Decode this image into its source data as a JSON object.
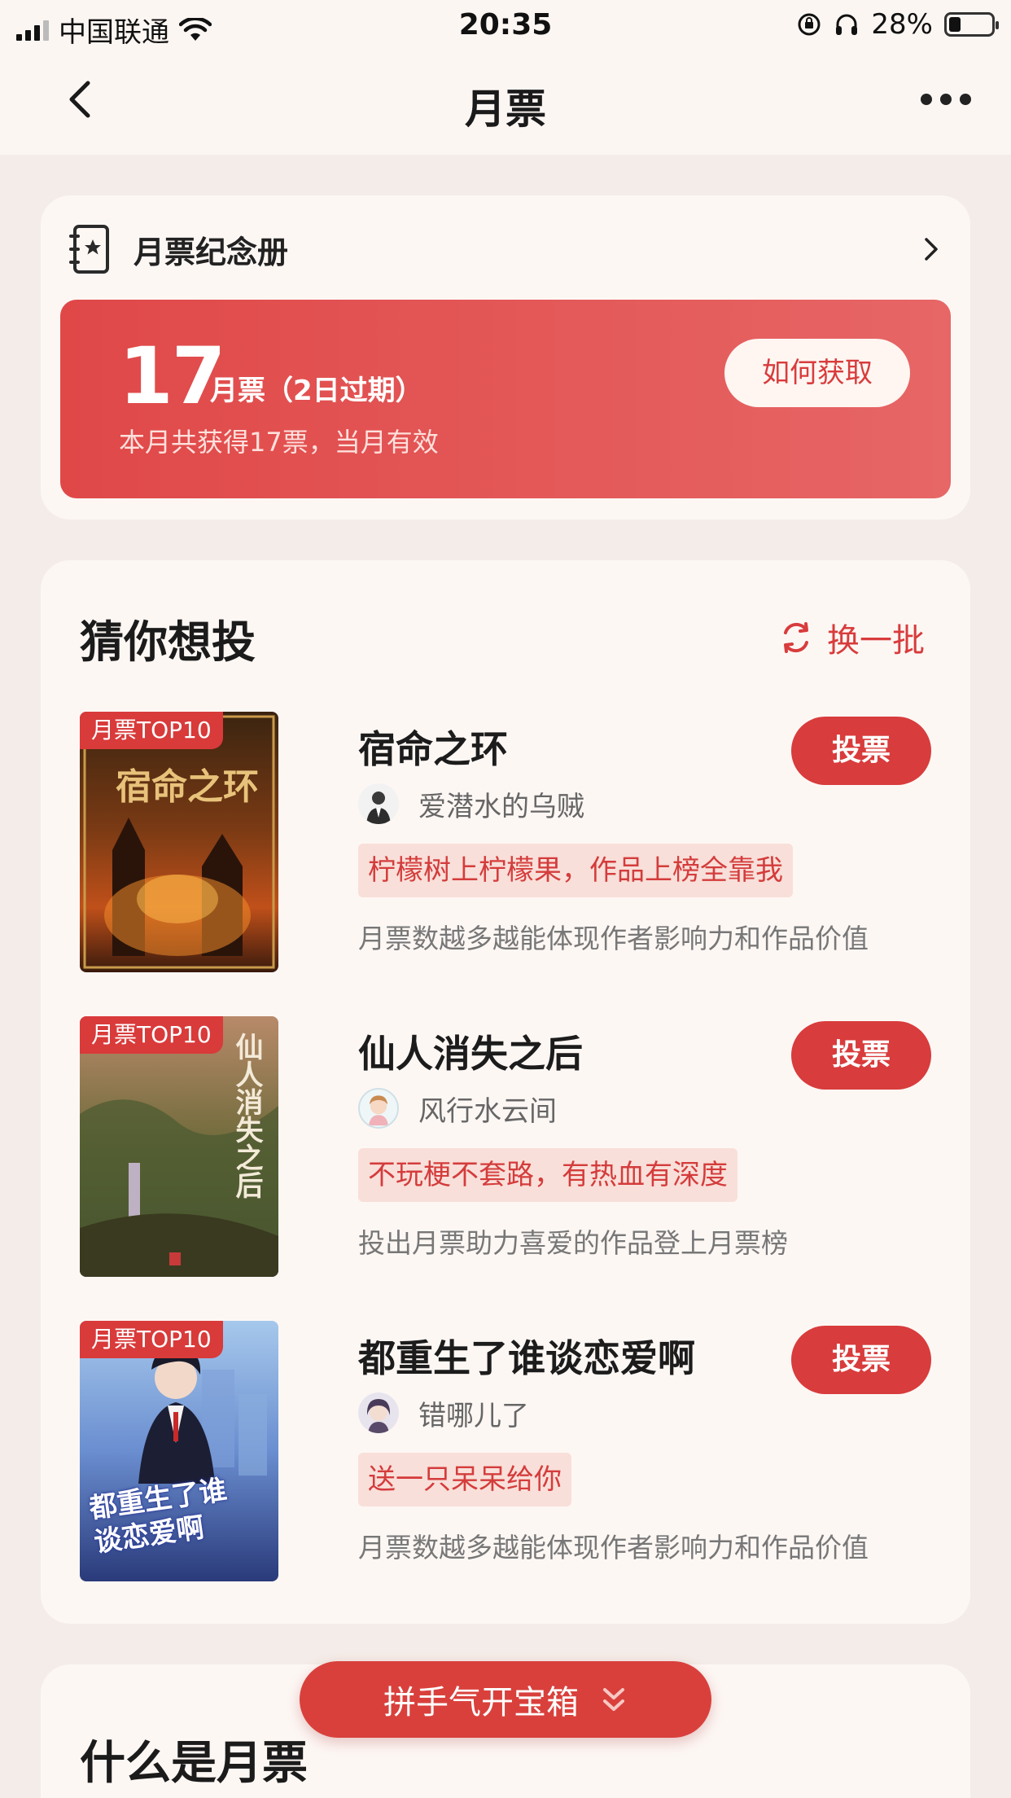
{
  "status_bar": {
    "carrier": "中国联通",
    "time": "20:35",
    "battery": "28%"
  },
  "nav": {
    "title": "月票"
  },
  "album": {
    "title": "月票纪念册"
  },
  "ticket": {
    "count": "17",
    "unit": "月票（2日过期）",
    "subtitle": "本月共获得17票，当月有效",
    "how_button": "如何获取"
  },
  "recommend": {
    "title": "猜你想投",
    "refresh": "换一批",
    "books": [
      {
        "tag": "月票TOP10",
        "cover_title": "宿命之环",
        "name": "宿命之环",
        "author": "爱潜水的乌贼",
        "slogan": "柠檬树上柠檬果，作品上榜全靠我",
        "desc": "月票数越多越能体现作者影响力和作品价值",
        "vote": "投票"
      },
      {
        "tag": "月票TOP10",
        "cover_title": "仙人消失之后",
        "name": "仙人消失之后",
        "author": "风行水云间",
        "slogan": "不玩梗不套路，有热血有深度",
        "desc": "投出月票助力喜爱的作品登上月票榜",
        "vote": "投票"
      },
      {
        "tag": "月票TOP10",
        "cover_title": "都重生了谁谈恋爱啊",
        "name": "都重生了谁谈恋爱啊",
        "author": "错哪儿了",
        "slogan": "送一只呆呆给你",
        "desc": "月票数越多越能体现作者影响力和作品价值",
        "vote": "投票"
      }
    ]
  },
  "what": {
    "title": "什么是月票"
  },
  "floating_button": {
    "label": "拼手气开宝箱"
  },
  "colors": {
    "accent": "#d83c3c",
    "background": "#f4ece8",
    "card": "#fdf7f4"
  }
}
